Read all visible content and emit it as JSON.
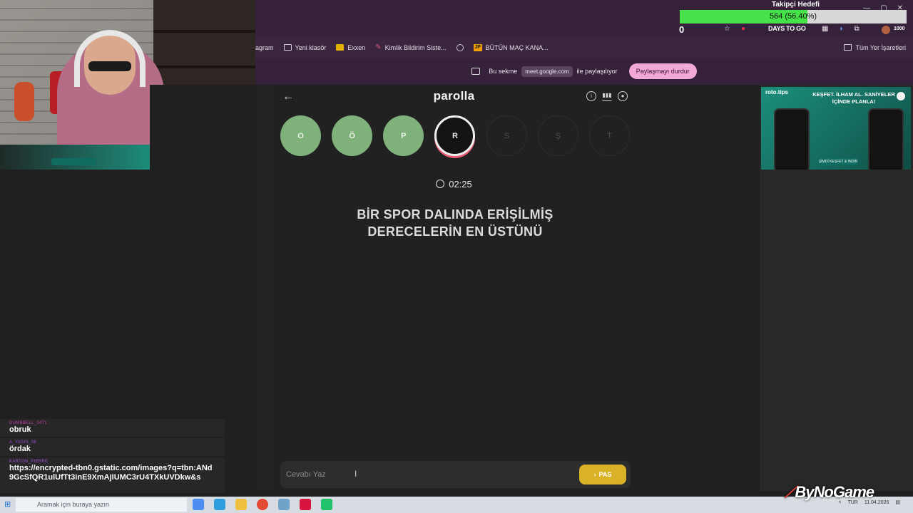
{
  "stream_overlay": {
    "follower_goal_title": "Takipçi Hedefi",
    "follower_goal_text": "564 (56.40%)",
    "follower_goal_progress": 0.564,
    "counter": "0",
    "days_to_go": "DAYS TO GO",
    "mini_count": "1000",
    "watermark": "ByNoGame"
  },
  "bookmarks": {
    "items": [
      {
        "label": "agram",
        "icon": "none"
      },
      {
        "label": "Yeni klasör",
        "icon": "folder-icon"
      },
      {
        "label": "Exxen",
        "icon": "exxen-icon"
      },
      {
        "label": "Kimlik Bildirim Siste...",
        "icon": "kimlik-icon"
      },
      {
        "label": "",
        "icon": "globe-icon"
      },
      {
        "label": "BÜTÜN MAÇ KANA...",
        "icon": "jp-icon"
      }
    ],
    "all_bookmarks": "Tüm Yer İşaretleri",
    "jp_badge": "JP"
  },
  "share_bar": {
    "prefix": "Bu sekme",
    "domain": "meet.google.com",
    "suffix": "ile paylaşılıyor",
    "stop_label": "Paylaşmayı durdur"
  },
  "game": {
    "title": "parolla",
    "letters": [
      {
        "char": "O",
        "state": "done"
      },
      {
        "char": "Ö",
        "state": "done"
      },
      {
        "char": "P",
        "state": "done"
      },
      {
        "char": "R",
        "state": "current"
      },
      {
        "char": "S",
        "state": "todo"
      },
      {
        "char": "Ş",
        "state": "todo"
      },
      {
        "char": "T",
        "state": "todo"
      }
    ],
    "timer": "02:25",
    "question_line1": "BİR SPOR DALINDA ERİŞİLMİŞ",
    "question_line2": "DERECELERİN EN ÜSTÜNÜ",
    "answer_placeholder": "Cevabı Yaz",
    "pass_label": "PAS"
  },
  "ad": {
    "brand": "roto.tips",
    "headline": "KEŞFET. İLHAM AL. SANİYELER İÇİNDE PLANLA!",
    "cta": "ŞİMDİ KEŞFET & İNDİR"
  },
  "chat": [
    {
      "user": "DUMBBELL_0471",
      "text": "obruk"
    },
    {
      "user": "A_YASIN_08",
      "text": "ördak"
    },
    {
      "user": "KARTON_PIERRE",
      "text": "https://encrypted-tbn0.gstatic.com/images?q=tbn:ANd9GcSfQR1ulUfTt3inE9XmAjIUMC3rU4TXkUVDkw&s"
    }
  ],
  "taskbar": {
    "search_placeholder": "Aramak için buraya yazın",
    "lang": "TUR",
    "date": "11.04.2026"
  },
  "colors": {
    "done_letter": "#7fb17b",
    "current_ring": "#efefef",
    "current_accent": "#e85d75",
    "pass_button": "#d9b227",
    "share_stop": "#f2a9d8",
    "goal_fill": "#45e24a"
  }
}
